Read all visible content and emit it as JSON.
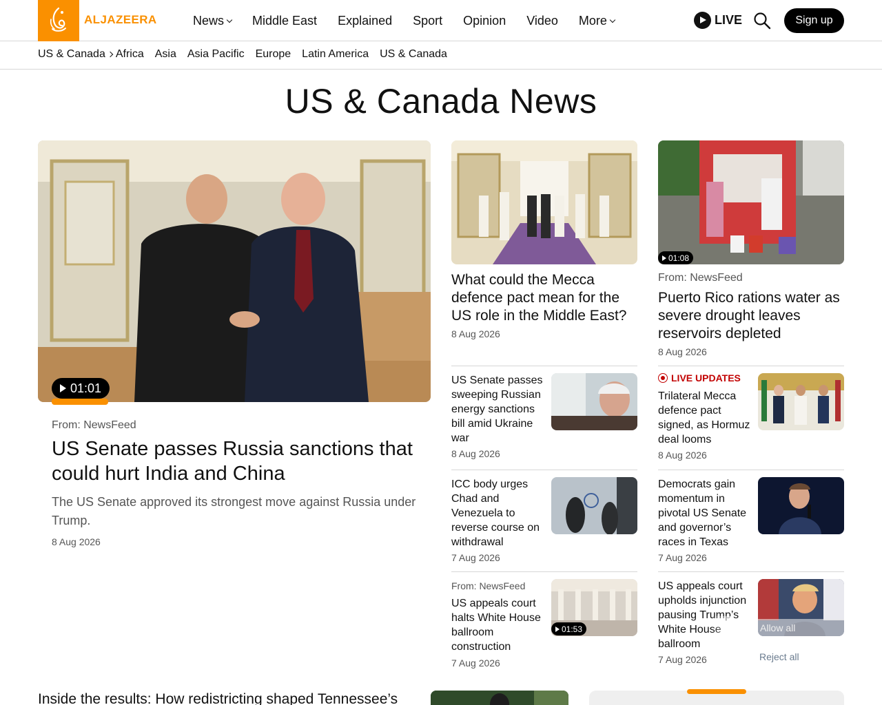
{
  "header": {
    "logo_text": "ALJAZEERA",
    "nav": [
      "News",
      "Middle East",
      "Explained",
      "Sport",
      "Opinion",
      "Video",
      "More"
    ],
    "live_label": "LIVE",
    "signup_label": "Sign up"
  },
  "subnav": {
    "breadcrumb": "US & Canada",
    "items": [
      "Africa",
      "Asia",
      "Asia Pacific",
      "Europe",
      "Latin America",
      "US & Canada"
    ]
  },
  "page_title": "US & Canada News",
  "featured": {
    "duration": "01:01",
    "from": "From: NewsFeed",
    "headline": "US Senate passes Russia sanctions that could hurt India and China",
    "description": "The US Senate approved its strongest move against Russia under Trump.",
    "date": "8 Aug 2026"
  },
  "cards": [
    {
      "headline": "What could the Mecca defence pact mean for the US role in the Middle East?",
      "date": "8 Aug 2026"
    },
    {
      "duration": "01:08",
      "from": "From: NewsFeed",
      "headline": "Puerto Rico rations water as severe drought leaves reservoirs depleted",
      "date": "8 Aug 2026"
    }
  ],
  "small_left": [
    {
      "headline": "US Senate passes sweeping Russian energy sanctions bill amid Ukraine war",
      "date": "8 Aug 2026"
    },
    {
      "headline": "ICC body urges Chad and Venezuela to reverse course on withdrawal",
      "date": "7 Aug 2026"
    },
    {
      "from": "From: NewsFeed",
      "headline": "US appeals court halts White House ballroom construction",
      "date": "7 Aug 2026",
      "duration": "01:53"
    }
  ],
  "small_right": [
    {
      "badge": "LIVE UPDATES",
      "headline": "Trilateral Mecca defence pact signed, as Hormuz deal looms",
      "date": "8 Aug 2026"
    },
    {
      "headline": "Democrats gain momentum in pivotal US Senate and governor’s races in Texas",
      "date": "7 Aug 2026"
    },
    {
      "headline": "US appeals court upholds injunction pausing Trump’s White House ballroom",
      "date": "7 Aug 2026"
    }
  ],
  "consent": {
    "allow": "Allow all",
    "reject": "Reject all"
  },
  "bottom": {
    "headline": "Inside the results: How redistricting shaped Tennessee’s"
  }
}
